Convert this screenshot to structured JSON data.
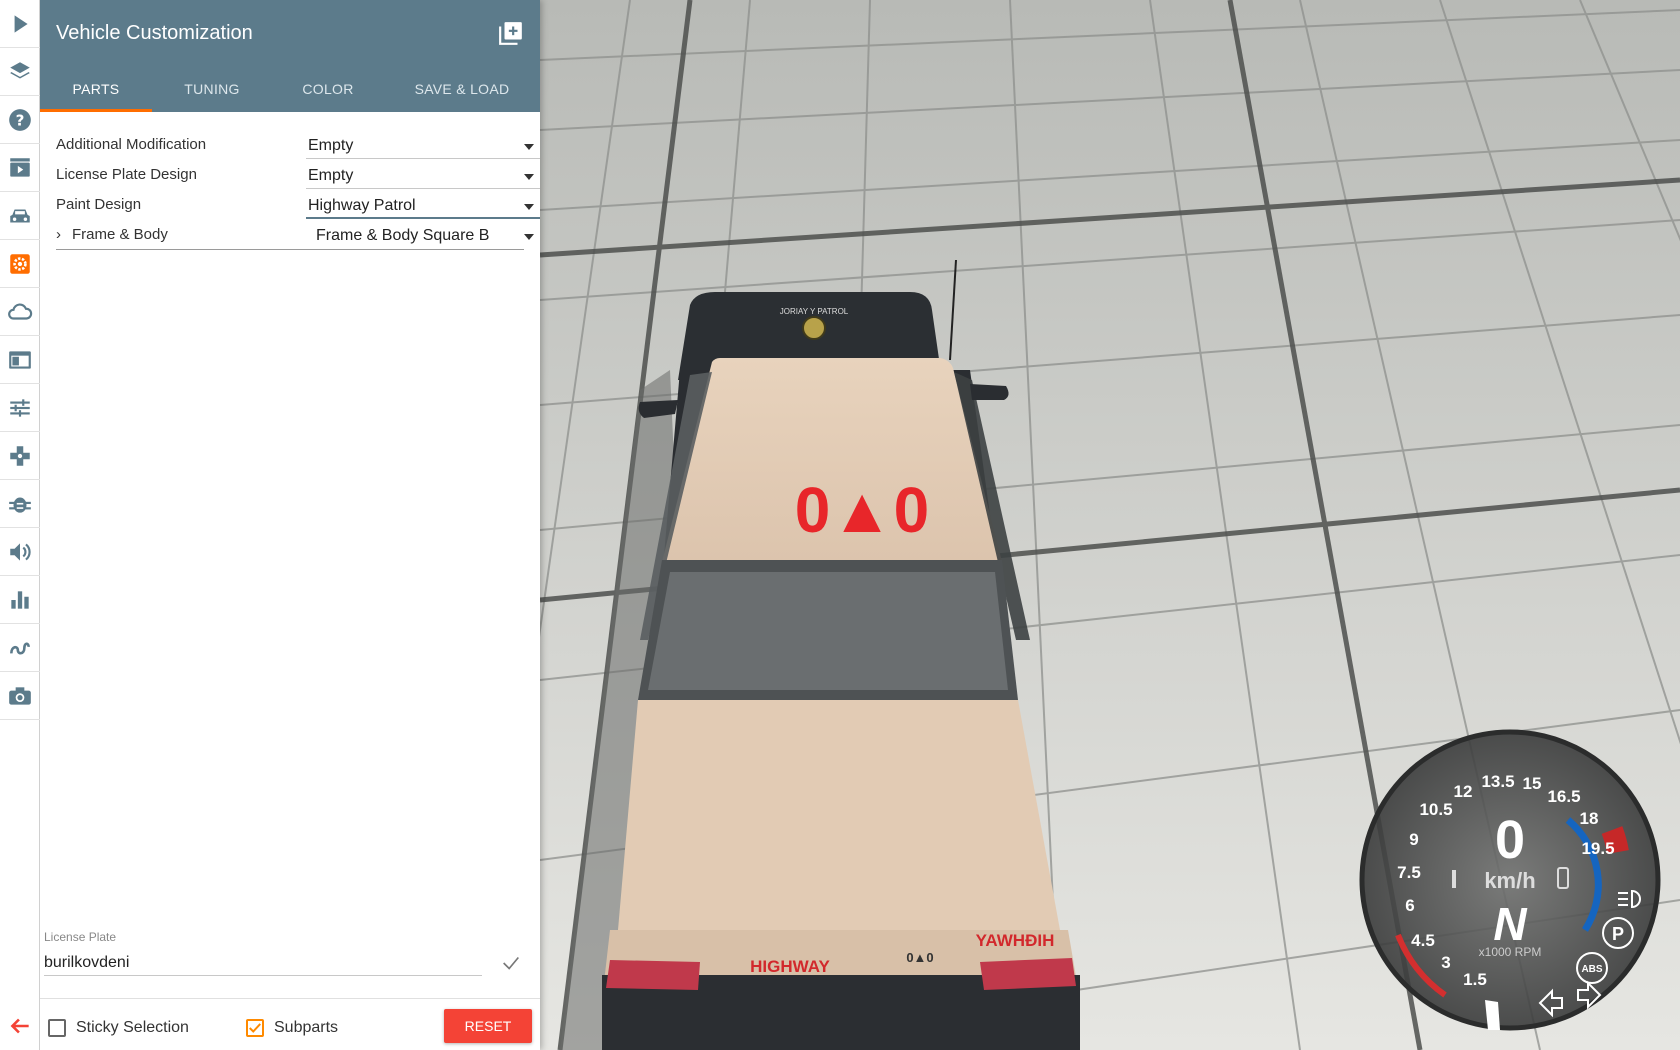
{
  "rail": {
    "icons": [
      "play-icon",
      "layers-icon",
      "help-icon",
      "clapper-icon",
      "car-icon",
      "gear-icon",
      "cloud-icon",
      "window-icon",
      "sliders-icon",
      "gamepad-icon",
      "bug-icon",
      "volume-icon",
      "bar-chart-icon",
      "path-icon",
      "camera-icon",
      "back-arrow-icon"
    ],
    "active": "gear-icon",
    "accent": "#ff6d00"
  },
  "panel": {
    "title": "Vehicle Customization",
    "header_color": "#5c7b8b",
    "tabs": [
      {
        "label": "PARTS",
        "active": true
      },
      {
        "label": "TUNING",
        "active": false
      },
      {
        "label": "COLOR",
        "active": false
      },
      {
        "label": "SAVE & LOAD",
        "active": false
      }
    ],
    "parts": [
      {
        "label": "Additional Modification",
        "value": "Empty"
      },
      {
        "label": "License Plate Design",
        "value": "Empty"
      },
      {
        "label": "Paint Design",
        "value": "Highway Patrol"
      },
      {
        "label": "Frame & Body",
        "value": "Frame & Body Square B"
      }
    ],
    "license_plate": {
      "label": "License Plate",
      "value": "burilkovdeni"
    },
    "footer": {
      "sticky_label": "Sticky Selection",
      "sticky_checked": false,
      "subparts_label": "Subparts",
      "subparts_checked": true,
      "reset_label": "RESET"
    }
  },
  "scene": {
    "car_roof_number": "0▲0",
    "car_trunk_left": "HIGHWAY",
    "car_trunk_right": "YAWHĐIH",
    "car_plate": "0▲0",
    "roof_badge_text": "JORIAY Y PATROL"
  },
  "gauge": {
    "speed": "0",
    "speed_unit": "km/h",
    "gear": "N",
    "rpm_unit": "x1000 RPM",
    "ticks": [
      "1.5",
      "3",
      "4.5",
      "6",
      "7.5",
      "9",
      "10.5",
      "12",
      "13.5",
      "15",
      "16.5",
      "18",
      "19.5"
    ],
    "abs_label": "ABS",
    "park_label": "P"
  }
}
